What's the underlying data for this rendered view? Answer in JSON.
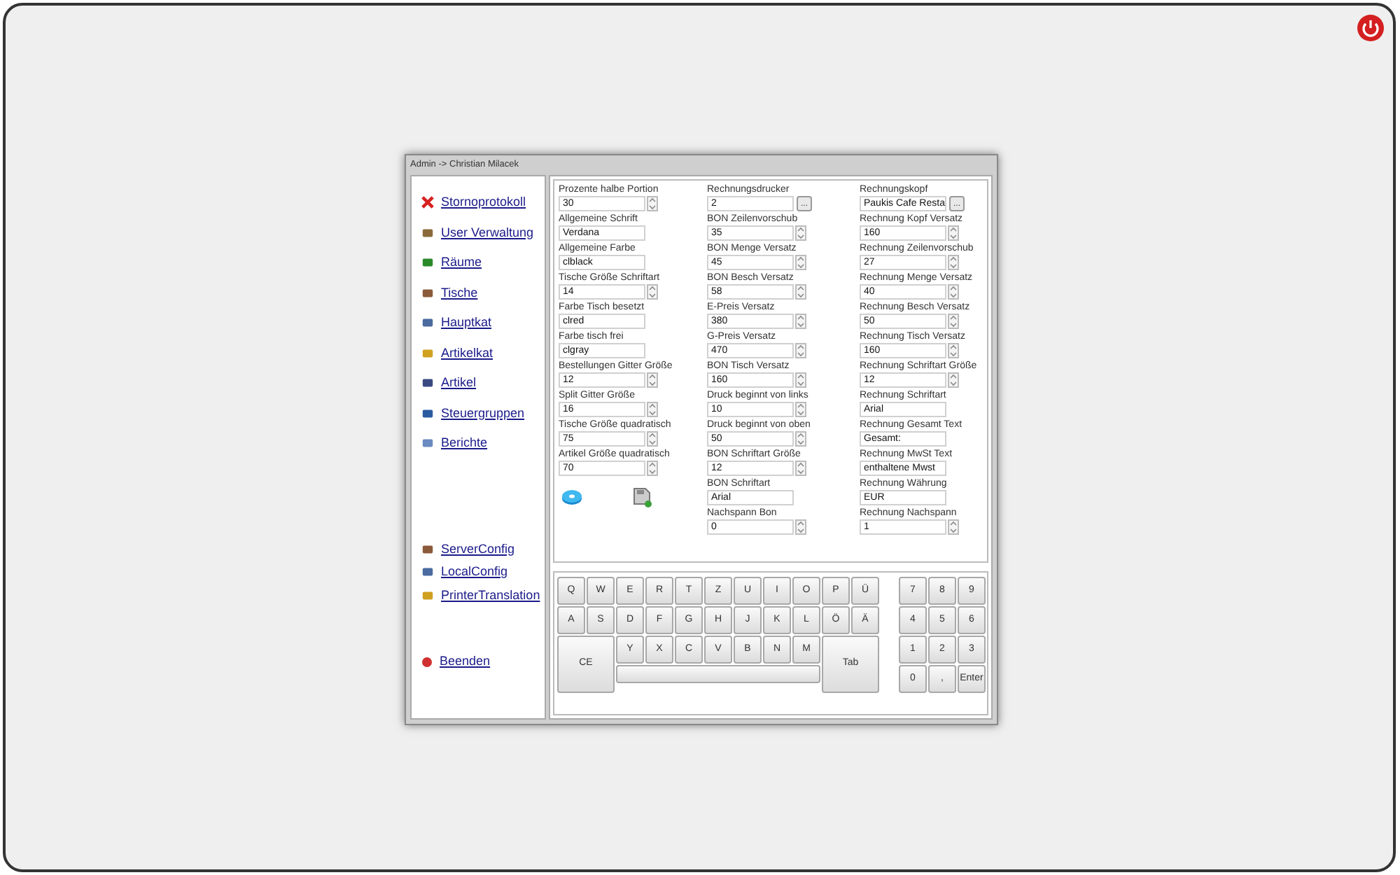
{
  "window": {
    "title": "Admin -> Christian Milacek"
  },
  "sidebar": {
    "main": [
      {
        "label": "Stornoprotokoll"
      },
      {
        "label": "User Verwaltung"
      },
      {
        "label": "Räume"
      },
      {
        "label": "Tische"
      },
      {
        "label": "Hauptkat"
      },
      {
        "label": "Artikelkat"
      },
      {
        "label": "Artikel"
      },
      {
        "label": "Steuergruppen"
      },
      {
        "label": "Berichte"
      }
    ],
    "config": [
      {
        "label": "ServerConfig"
      },
      {
        "label": "LocalConfig"
      },
      {
        "label": "PrinterTranslation"
      }
    ],
    "exit": [
      {
        "label": "Beenden"
      }
    ]
  },
  "form_columns": [
    [
      {
        "label": "Prozente halbe Portion",
        "value": "30",
        "kind": "spin"
      },
      {
        "label": "Allgemeine Schrift",
        "value": "Verdana",
        "kind": "text"
      },
      {
        "label": "Allgemeine Farbe",
        "value": "clblack",
        "kind": "text"
      },
      {
        "label": "Tische Größe Schriftart",
        "value": "14",
        "kind": "spin"
      },
      {
        "label": "Farbe Tisch besetzt",
        "value": "clred",
        "kind": "text"
      },
      {
        "label": "Farbe tisch frei",
        "value": "clgray",
        "kind": "text"
      },
      {
        "label": "Bestellungen Gitter Größe",
        "value": "12",
        "kind": "spin"
      },
      {
        "label": "Split Gitter Größe",
        "value": "16",
        "kind": "spin"
      },
      {
        "label": "Tische Größe quadratisch",
        "value": "75",
        "kind": "spin"
      },
      {
        "label": "Artikel  Größe quadratisch",
        "value": "70",
        "kind": "spin"
      }
    ],
    [
      {
        "label": "Rechnungsdrucker",
        "value": "2",
        "kind": "browse",
        "button": "..."
      },
      {
        "label": "BON Zeilenvorschub",
        "value": "35",
        "kind": "spin"
      },
      {
        "label": "BON Menge Versatz",
        "value": "45",
        "kind": "spin"
      },
      {
        "label": "BON Besch Versatz",
        "value": "58",
        "kind": "spin"
      },
      {
        "label": "E-Preis Versatz",
        "value": "380",
        "kind": "spin"
      },
      {
        "label": "G-Preis Versatz",
        "value": "470",
        "kind": "spin"
      },
      {
        "label": "BON Tisch Versatz",
        "value": "160",
        "kind": "spin"
      },
      {
        "label": "Druck beginnt von links",
        "value": "10",
        "kind": "spin"
      },
      {
        "label": "Druck beginnt von oben",
        "value": "50",
        "kind": "spin"
      },
      {
        "label": "BON Schriftart Größe",
        "value": "12",
        "kind": "spin"
      },
      {
        "label": "BON Schriftart",
        "value": "Arial",
        "kind": "text"
      },
      {
        "label": "Nachspann Bon",
        "value": "0",
        "kind": "spin"
      }
    ],
    [
      {
        "label": "Rechnungskopf",
        "value": "Paukis Cafe Resta",
        "kind": "browse",
        "button": "..."
      },
      {
        "label": "Rechnung Kopf Versatz",
        "value": "160",
        "kind": "spin"
      },
      {
        "label": "Rechnung Zeilenvorschub",
        "value": "27",
        "kind": "spin"
      },
      {
        "label": "Rechnung Menge Versatz",
        "value": "40",
        "kind": "spin"
      },
      {
        "label": "Rechnung Besch Versatz",
        "value": "50",
        "kind": "spin"
      },
      {
        "label": "Rechnung Tisch Versatz",
        "value": "160",
        "kind": "spin"
      },
      {
        "label": "Rechnung Schriftart Größe",
        "value": "12",
        "kind": "spin"
      },
      {
        "label": "Rechnung Schriftart",
        "value": "Arial",
        "kind": "text"
      },
      {
        "label": "Rechnung Gesamt Text",
        "value": "Gesamt:",
        "kind": "text"
      },
      {
        "label": "Rechnung MwSt Text",
        "value": "enthaltene Mwst",
        "kind": "text"
      },
      {
        "label": "Rechnung Währung",
        "value": "EUR",
        "kind": "text"
      },
      {
        "label": "Rechnung Nachspann",
        "value": "1",
        "kind": "spin"
      }
    ]
  ],
  "keyboard": {
    "row1": [
      "Q",
      "W",
      "E",
      "R",
      "T",
      "Z",
      "U",
      "I",
      "O",
      "P",
      "Ü"
    ],
    "row2": [
      "A",
      "S",
      "D",
      "F",
      "G",
      "H",
      "J",
      "K",
      "L",
      "Ö",
      "Ä"
    ],
    "row3": [
      "Y",
      "X",
      "C",
      "V",
      "B",
      "N",
      "M"
    ],
    "clear_key": "CE",
    "tab_key": "Tab",
    "numpad": [
      "7",
      "8",
      "9",
      "4",
      "5",
      "6",
      "1",
      "2",
      "3",
      "0",
      ",",
      "Enter"
    ]
  }
}
